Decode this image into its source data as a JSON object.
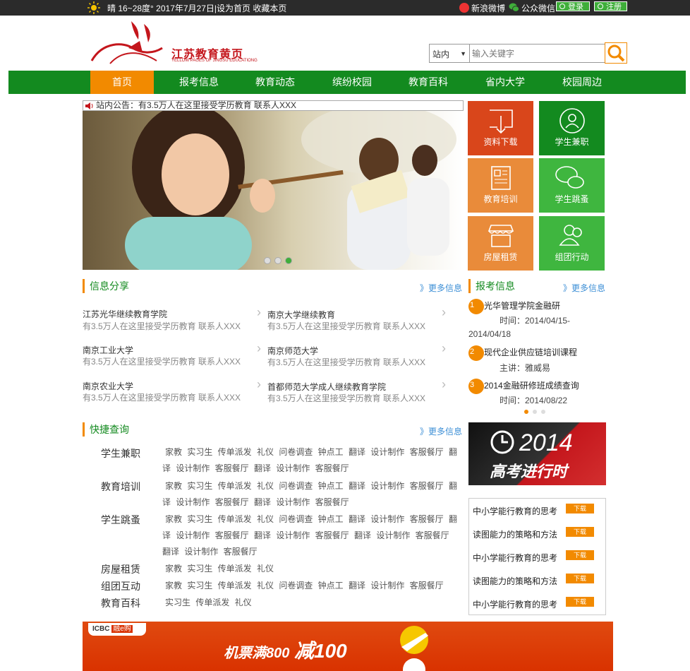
{
  "topbar": {
    "weather": "晴 16~28度° 2017年7月27日|设为首页 收藏本页",
    "weibo": "新浪微博",
    "wechat": "公众微信",
    "login": "登录",
    "register": "注册"
  },
  "logo": {
    "name": "江苏教育黄页",
    "subtitle": "YELLOW PAGES OF JINGSU EDUCATIONG"
  },
  "search": {
    "scope": "站内",
    "placeholder": "输入关键字"
  },
  "nav": [
    "首页",
    "报考信息",
    "教育动态",
    "缤纷校园",
    "教育百科",
    "省内大学",
    "校园周边"
  ],
  "notice": "站内公告：有3.5万人在这里接受学历教育 联系人XXX",
  "tiles": [
    "资料下载",
    "学生兼职",
    "教育培训",
    "学生跳蚤",
    "房屋租赁",
    "组团行动"
  ],
  "colors": {
    "green": "#138a1f",
    "orange": "#f28a00",
    "tile_red": "#d9461b",
    "tile_orange": "#e98b3a",
    "tile_green": "#3fb63f"
  },
  "info_share": {
    "title": "信息分享",
    "more": "》更多信息",
    "items": [
      {
        "name": "江苏光华继续教育学院",
        "desc": "有3.5万人在这里接受学历教育 联系人XXX"
      },
      {
        "name": "南京大学继续教育",
        "desc": "有3.5万人在这里接受学历教育 联系人XXX"
      },
      {
        "name": "南京工业大学",
        "desc": "有3.5万人在这里接受学历教育 联系人XXX"
      },
      {
        "name": "南京师范大学",
        "desc": "有3.5万人在这里接受学历教育 联系人XXX"
      },
      {
        "name": "南京农业大学",
        "desc": "有3.5万人在这里接受学历教育 联系人XXX"
      },
      {
        "name": "首都师范大学成人继续教育学院",
        "desc": "有3.5万人在这里接受学历教育 联系人XXX"
      }
    ]
  },
  "exam_info": {
    "title": "报考信息",
    "more": "》更多信息",
    "items": [
      {
        "num": "1",
        "title": "光华管理学院金融研",
        "sub1": "时间：2014/04/15-",
        "sub2": "2014/04/18"
      },
      {
        "num": "2",
        "title": "现代企业供应链培训课程",
        "sub1": "主讲：雅威易"
      },
      {
        "num": "3",
        "title": "2014金融研修班成绩查询",
        "sub1": "时间：2014/08/22"
      }
    ]
  },
  "quick_query": {
    "title": "快捷查询",
    "more": "》更多信息",
    "cats": [
      {
        "name": "学生兼职",
        "tags": "家教 实习生 传单派发 礼仪 问卷调查 钟点工 翻译 设计制作 客服餐厅 翻译 设计制作 客服餐厅 翻译 设计制作 客服餐厅"
      },
      {
        "name": "教育培训",
        "tags": "家教 实习生 传单派发 礼仪 问卷调查 钟点工 翻译 设计制作 客服餐厅 翻译 设计制作 客服餐厅 翻译 设计制作 客服餐厅"
      },
      {
        "name": "学生跳蚤",
        "tags": "家教 实习生 传单派发 礼仪 问卷调查 钟点工 翻译 设计制作 客服餐厅 翻译 设计制作 客服餐厅 翻译 设计制作 客服餐厅 翻译 设计制作 客服餐厅 翻译 设计制作 客服餐厅"
      },
      {
        "name": "房屋租赁",
        "tags": "家教 实习生 传单派发 礼仪"
      },
      {
        "name": "组团互动",
        "tags": "家教 实习生 传单派发 礼仪 问卷调查 钟点工 翻译 设计制作 客服餐厅"
      },
      {
        "name": "教育百科",
        "tags": "实习生 传单派发 礼仪"
      }
    ]
  },
  "promo_2014": {
    "year": "2014",
    "text": "高考进行时"
  },
  "downloads": {
    "items": [
      "中小学能行教育的思考",
      "读图能力的策略和方法",
      "中小学能行教育的思考",
      "读图能力的策略和方法",
      "中小学能行教育的思考"
    ],
    "btn": "下载"
  },
  "ad": {
    "brand": "ICBC",
    "brand2": "融e购",
    "text1": "机票满800",
    "text2": "减100"
  }
}
